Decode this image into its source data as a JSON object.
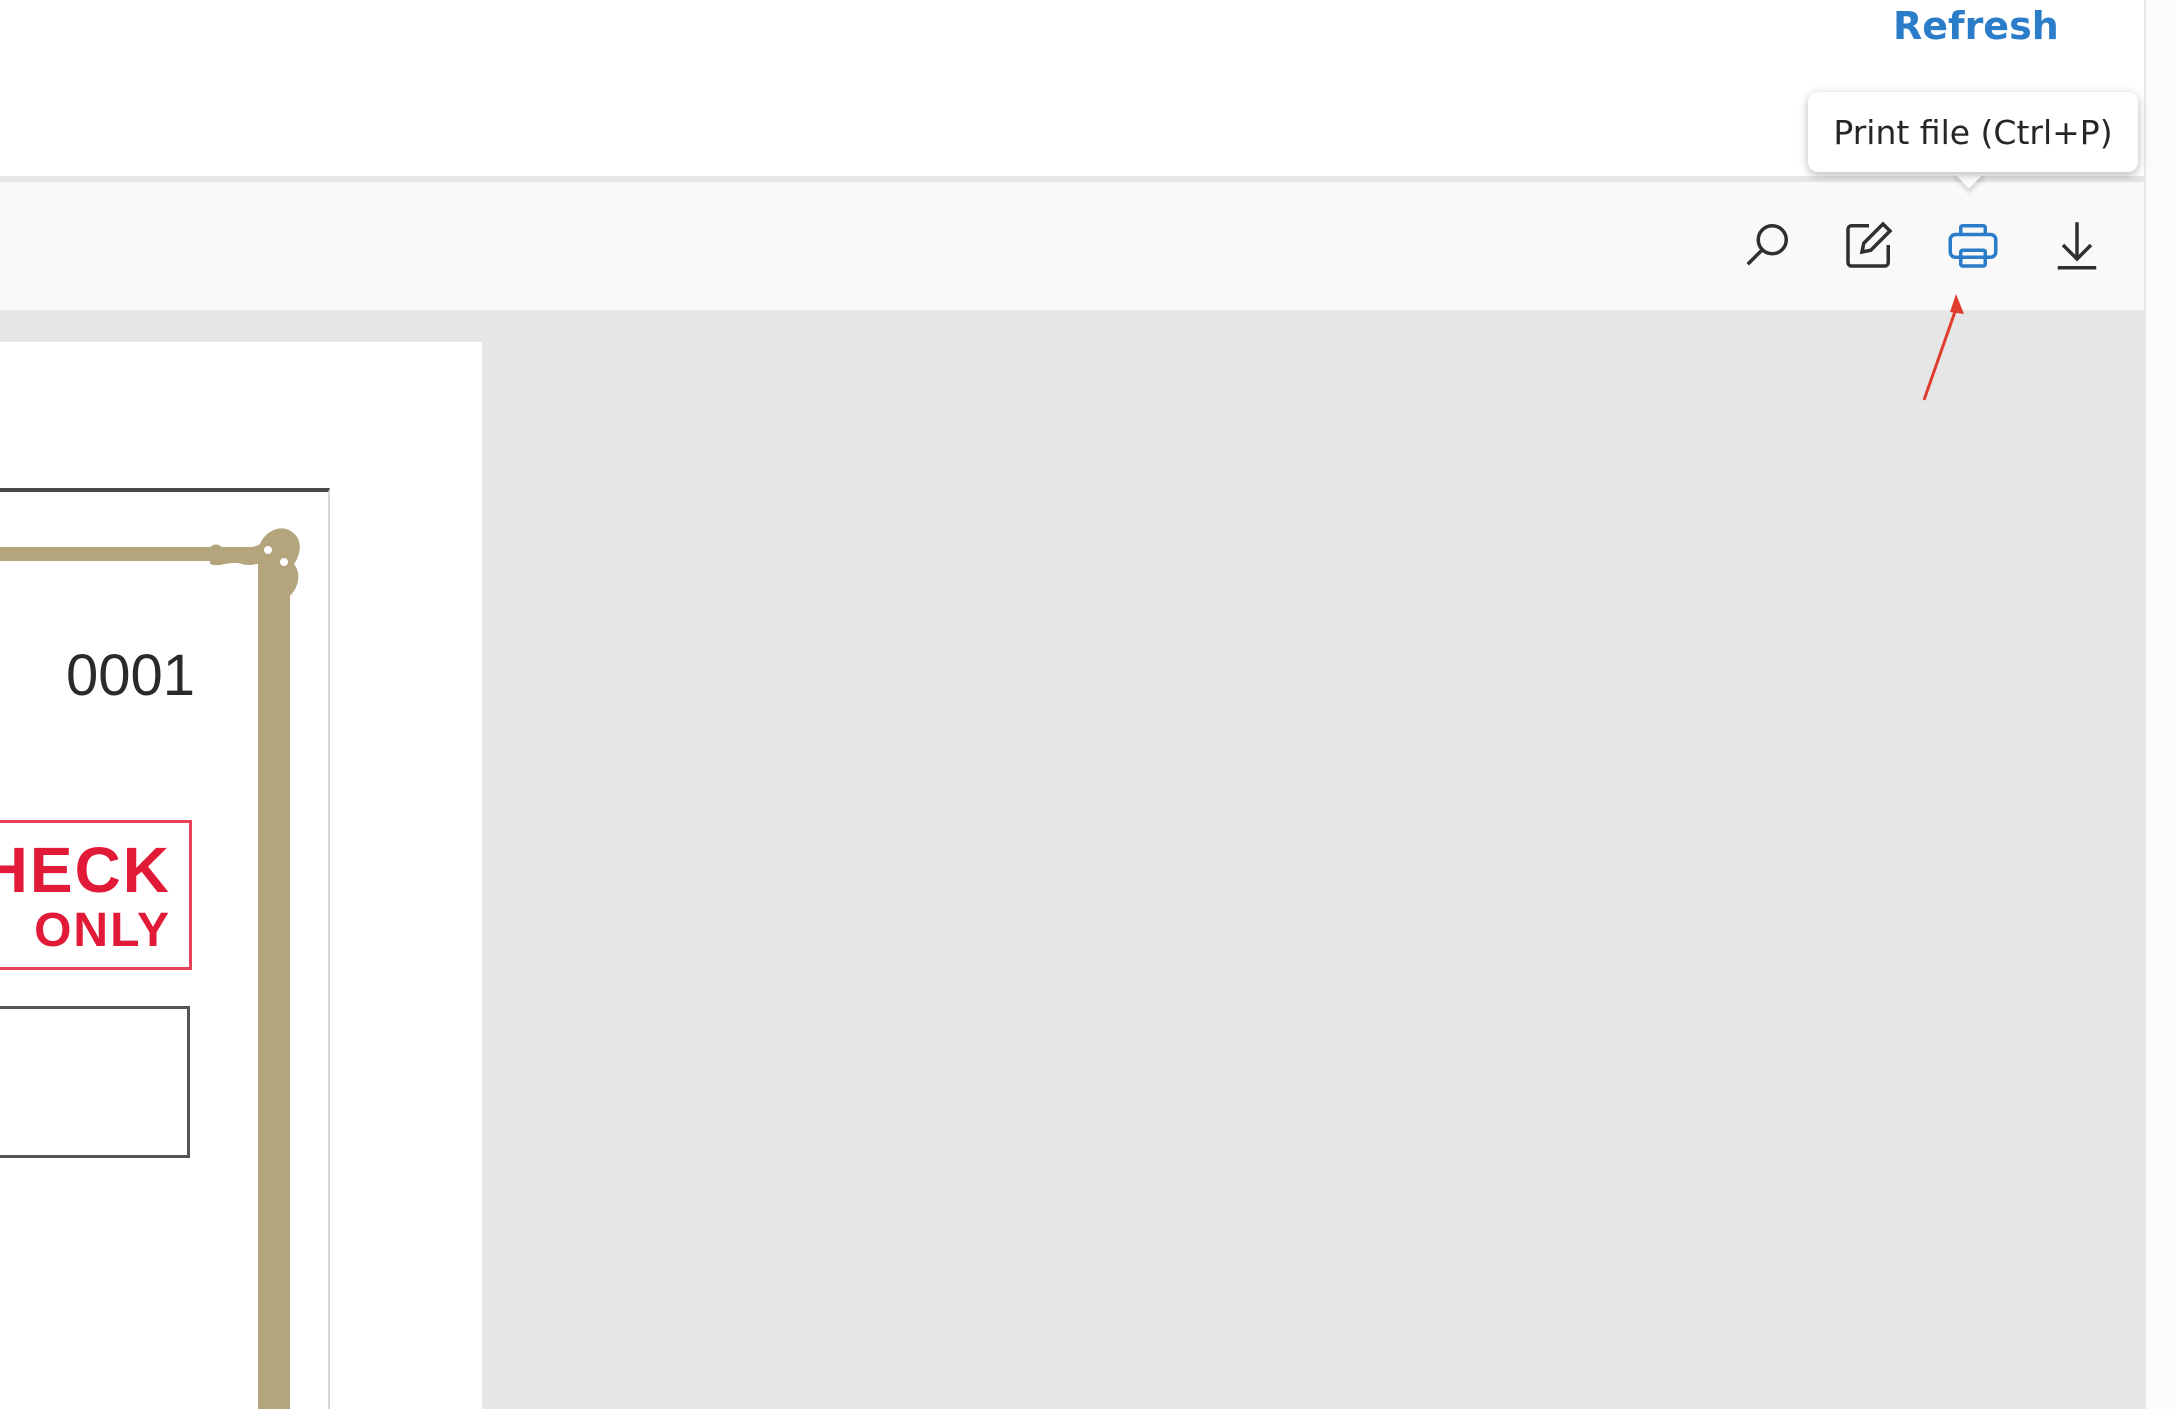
{
  "header": {
    "refresh_label": "Refresh"
  },
  "tooltip": {
    "text": "Print file (Ctrl+P)"
  },
  "toolbar": {
    "buttons": [
      {
        "icon": "search-icon"
      },
      {
        "icon": "edit-icon"
      },
      {
        "icon": "print-icon"
      },
      {
        "icon": "download-icon"
      }
    ]
  },
  "document": {
    "check_number": "0001",
    "stamp_line1": "HECK",
    "stamp_line2": "ONLY"
  },
  "colors": {
    "accent": "#2b7cc9",
    "print_icon": "#2b7cc9",
    "stamp_red": "#e11a37",
    "border_gold": "#b4a57d",
    "annotation_arrow": "#e03c2e",
    "viewer_bg": "#e6e6e6"
  }
}
